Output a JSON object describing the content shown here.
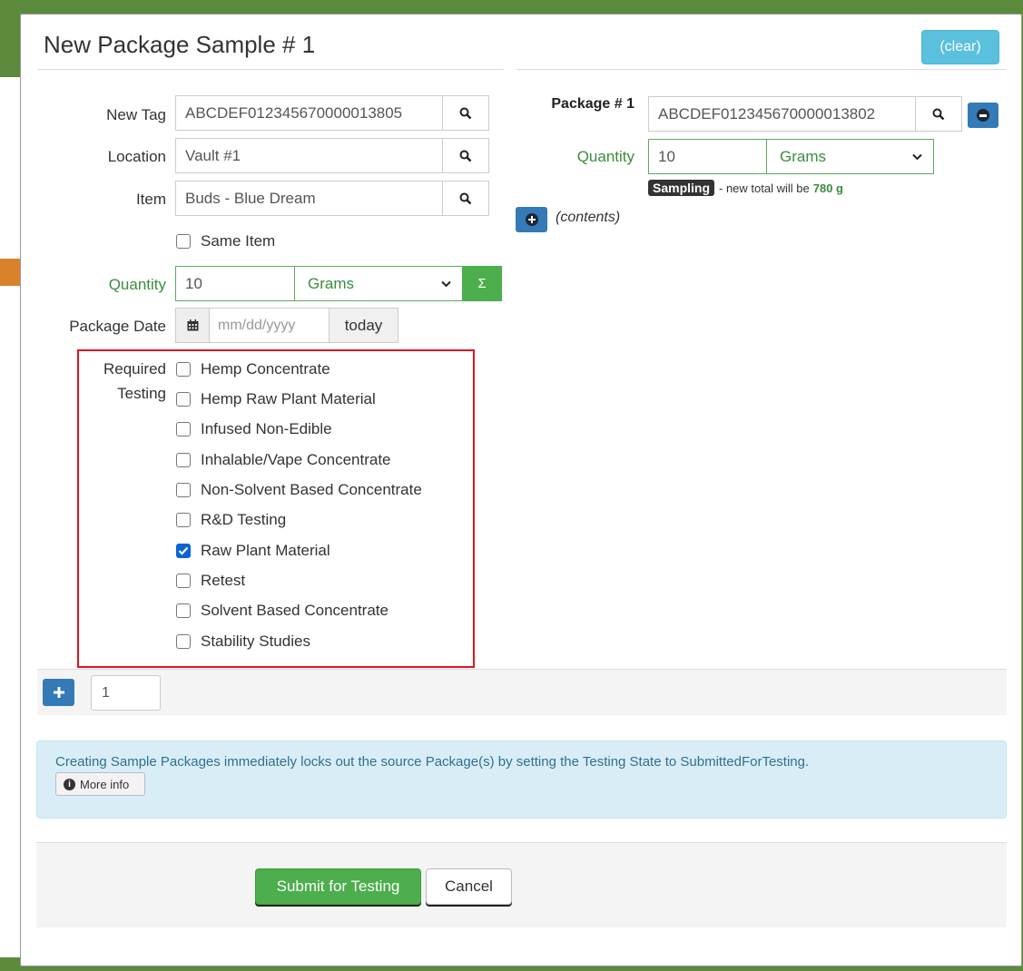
{
  "header": {
    "title": "New Package Sample # 1",
    "clear_label": "(clear)"
  },
  "form": {
    "new_tag": {
      "label": "New Tag",
      "value": "ABCDEF012345670000013805"
    },
    "location": {
      "label": "Location",
      "value": "Vault #1"
    },
    "item": {
      "label": "Item",
      "value": "Buds - Blue Dream"
    },
    "same_item": {
      "label": "Same Item",
      "checked": false
    },
    "quantity": {
      "label": "Quantity",
      "value": "10",
      "unit": "Grams",
      "sum_label": "Σ"
    },
    "package_date": {
      "label": "Package Date",
      "placeholder": "mm/dd/yyyy",
      "today_label": "today"
    },
    "required_testing": {
      "label_line1": "Required",
      "label_line2": "Testing",
      "options": [
        {
          "label": "Hemp Concentrate",
          "checked": false
        },
        {
          "label": "Hemp Raw Plant Material",
          "checked": false
        },
        {
          "label": "Infused Non-Edible",
          "checked": false
        },
        {
          "label": "Inhalable/Vape Concentrate",
          "checked": false
        },
        {
          "label": "Non-Solvent Based Concentrate",
          "checked": false
        },
        {
          "label": "R&D Testing",
          "checked": false
        },
        {
          "label": "Raw Plant Material",
          "checked": true
        },
        {
          "label": "Retest",
          "checked": false
        },
        {
          "label": "Solvent Based Concentrate",
          "checked": false
        },
        {
          "label": "Stability Studies",
          "checked": false
        }
      ]
    }
  },
  "source_package": {
    "label": "Package # 1",
    "tag": "ABCDEF012345670000013802",
    "quantity_label": "Quantity",
    "quantity": "10",
    "unit": "Grams",
    "badge": "Sampling",
    "note_prefix": "- new total will be",
    "new_total": "780 g",
    "contents_label": "(contents)"
  },
  "add_row": {
    "count": "1"
  },
  "info": {
    "message": "Creating Sample Packages immediately locks out the source Package(s) by setting the Testing State to SubmittedForTesting.",
    "more_info_label": "More info"
  },
  "footer": {
    "submit_label": "Submit for Testing",
    "cancel_label": "Cancel"
  },
  "colors": {
    "primary": "#337ab7",
    "success": "#4cae4c",
    "info": "#5bc0de",
    "highlight_frame": "#e0141e"
  }
}
